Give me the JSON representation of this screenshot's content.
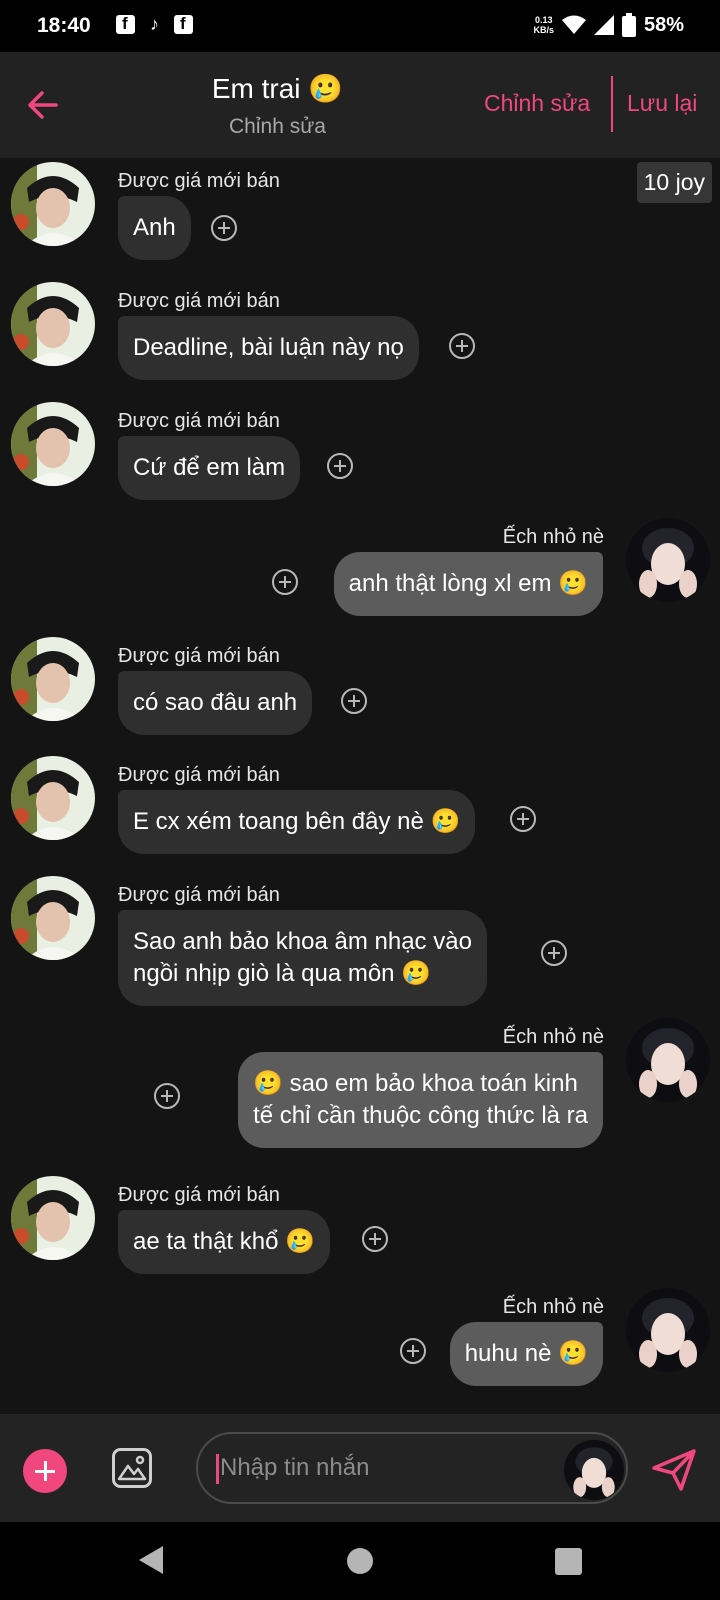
{
  "status_bar": {
    "time": "18:40",
    "app_icons": [
      "facebook-icon",
      "tiktok-icon",
      "facebook-icon"
    ],
    "speed_value": "0.13",
    "speed_unit": "KB/s",
    "battery": "58%"
  },
  "header": {
    "title": "Em trai 🥲",
    "subtitle": "Chỉnh sửa",
    "edit_label": "Chỉnh sửa",
    "save_label": "Lưu lại"
  },
  "joy_badge": "10 joy",
  "messages": [
    {
      "side": "in",
      "name": "Được giá mới bán",
      "lines": [
        "Anh"
      ]
    },
    {
      "side": "in",
      "name": "Được giá mới bán",
      "lines": [
        "Deadline, bài luận này nọ"
      ]
    },
    {
      "side": "in",
      "name": "Được giá mới bán",
      "lines": [
        "Cứ để em làm"
      ]
    },
    {
      "side": "out",
      "name": "Ếch nhỏ nè",
      "lines": [
        "anh thật lòng xl em 🥲"
      ]
    },
    {
      "side": "in",
      "name": "Được giá mới bán",
      "lines": [
        "có sao đâu anh"
      ]
    },
    {
      "side": "in",
      "name": "Được giá mới bán",
      "lines": [
        "E cx xém toang bên đây nè 🥲"
      ]
    },
    {
      "side": "in",
      "name": "Được giá mới bán",
      "lines": [
        "Sao anh bảo khoa âm nhạc vào",
        "ngồi nhịp giò là qua môn 🥲"
      ]
    },
    {
      "side": "out",
      "name": "Ếch nhỏ nè",
      "lines": [
        "🥲 sao em bảo khoa toán kinh",
        "tế chỉ cần thuộc công thức là ra"
      ]
    },
    {
      "side": "in",
      "name": "Được giá mới bán",
      "lines": [
        "ae ta thật khổ 🥲"
      ]
    },
    {
      "side": "out",
      "name": "Ếch nhỏ nè",
      "lines": [
        "huhu nè 🥲"
      ]
    }
  ],
  "composer": {
    "placeholder": "Nhập tin nhắn"
  },
  "colors": {
    "accent": "#f0487e",
    "background": "#141414",
    "header": "#222222",
    "bubble_in": "#2f2f2f",
    "bubble_out": "#5c5c5c"
  }
}
